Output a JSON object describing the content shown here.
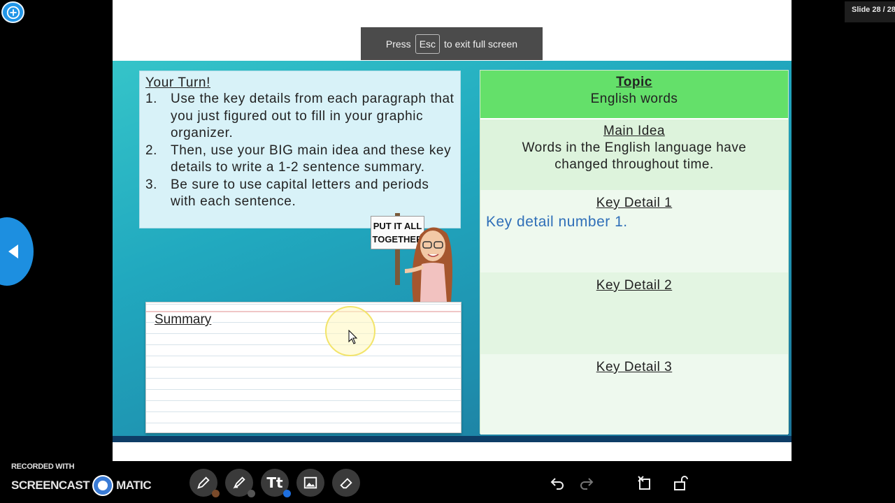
{
  "viewer": {
    "slide_counter": "Slide 28 / 28"
  },
  "toast": {
    "press": "Press",
    "key": "Esc",
    "rest": "to exit full screen"
  },
  "slide": {
    "turn": {
      "title": "Your Turn!",
      "items": [
        {
          "num": "1.",
          "text": "Use the key details from each paragraph that you just figured out to fill in your graphic organizer."
        },
        {
          "num": "2.",
          "text": "Then, use your BIG main idea and these key details to write a 1-2 sentence summary."
        },
        {
          "num": "3.",
          "text": "Be sure to use capital letters and periods with each sentence."
        }
      ]
    },
    "sign": {
      "line1": "PUT IT ALL",
      "line2": "TOGETHER"
    },
    "summary_title": "Summary",
    "organizer": {
      "topic_heading": "Topic",
      "topic_value": "English words",
      "main_heading": "Main Idea",
      "main_value": "Words in the English language have changed throughout time.",
      "key1_heading": "Key Detail 1",
      "key1_value": "Key detail number 1.",
      "key2_heading": "Key Detail 2",
      "key3_heading": "Key Detail 3"
    },
    "colors": {
      "topic_bg": "#64e06a",
      "slide_gradient_start": "#35c4c9",
      "slide_gradient_end": "#1c7296",
      "key_entry_text": "#2f6fb8"
    }
  },
  "recorder": {
    "label": "RECORDED WITH",
    "brand_left": "SCREENCAST",
    "brand_right": "MATIC"
  },
  "toolbar": {
    "tools": [
      {
        "name": "pen-icon",
        "dot_color": "#7a4a2a"
      },
      {
        "name": "highlighter-icon",
        "dot_color": "#555555"
      },
      {
        "name": "text-tool",
        "label": "Tt",
        "dot_color": "#1e6fe0"
      },
      {
        "name": "image-icon"
      },
      {
        "name": "eraser-icon"
      }
    ],
    "right": [
      "undo-icon",
      "redo-icon",
      "clear-icon",
      "lock-icon"
    ]
  }
}
